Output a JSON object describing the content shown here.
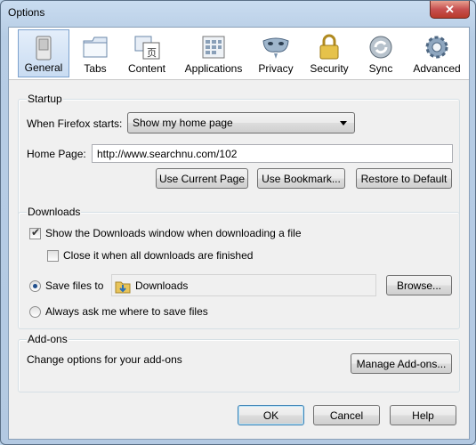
{
  "window": {
    "title": "Options",
    "close_glyph": "✕"
  },
  "toolbar": {
    "tabs": [
      {
        "label": "General",
        "icon": "switch-icon",
        "selected": true
      },
      {
        "label": "Tabs",
        "icon": "tabs-icon"
      },
      {
        "label": "Content",
        "icon": "content-icon"
      },
      {
        "label": "Applications",
        "icon": "applications-icon"
      },
      {
        "label": "Privacy",
        "icon": "mask-icon"
      },
      {
        "label": "Security",
        "icon": "padlock-icon"
      },
      {
        "label": "Sync",
        "icon": "sync-icon"
      },
      {
        "label": "Advanced",
        "icon": "gear-icon"
      }
    ]
  },
  "startup": {
    "legend": "Startup",
    "when_starts_label": "When Firefox starts:",
    "when_starts_value": "Show my home page",
    "home_page_label": "Home Page:",
    "home_page_value": "http://www.searchnu.com/102",
    "use_current_page": "Use Current Page",
    "use_bookmark": "Use Bookmark...",
    "restore_default": "Restore to Default"
  },
  "downloads": {
    "legend": "Downloads",
    "show_window_label": "Show the Downloads window when downloading a file",
    "show_window_checked": true,
    "close_when_done_label": "Close it when all downloads are finished",
    "close_when_done_checked": false,
    "save_files_label": "Save files to",
    "save_folder": "Downloads",
    "browse": "Browse...",
    "always_ask_label": "Always ask me where to save files"
  },
  "addons": {
    "legend": "Add-ons",
    "description": "Change options for your add-ons",
    "manage": "Manage Add-ons..."
  },
  "footer": {
    "ok": "OK",
    "cancel": "Cancel",
    "help": "Help"
  }
}
